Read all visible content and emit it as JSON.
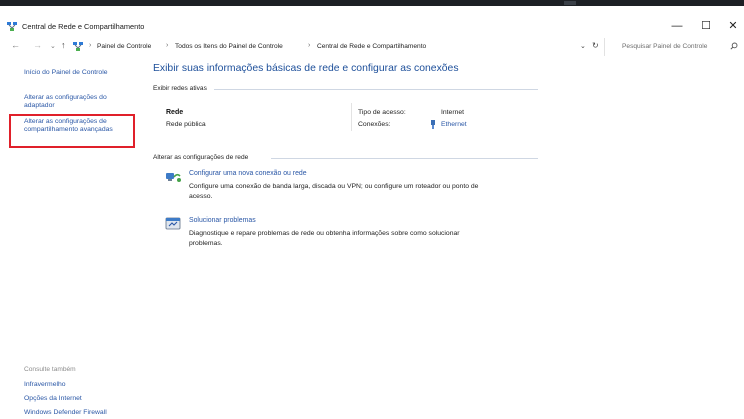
{
  "window": {
    "title": "Central de Rede e Compartilhamento",
    "controls": {
      "minimize": "—",
      "maximize": "☐",
      "close": "✕"
    }
  },
  "address_bar": {
    "back": "←",
    "forward": "→",
    "history": "⌄",
    "up": "↑",
    "lead_sep": "›",
    "breadcrumb": [
      "Painel de Controle",
      "Todos os Itens do Painel de Controle",
      "Central de Rede e Compartilhamento"
    ],
    "separator": "›",
    "dropdown": "⌄",
    "refresh": "↻",
    "search_placeholder": "Pesquisar Painel de Controle"
  },
  "sidebar": {
    "home": "Início do Painel de Controle",
    "change_adapter": [
      "Alterar as configurações do",
      "adaptador"
    ],
    "change_sharing": [
      "Alterar as configurações de",
      "compartilhamento avançadas"
    ],
    "see_also_title": "Consulte também",
    "see_also": [
      "Infravermelho",
      "Opções da Internet",
      "Windows Defender Firewall"
    ]
  },
  "main": {
    "heading": "Exibir suas informações básicas de rede e configurar as conexões",
    "active_networks_label": "Exibir redes ativas",
    "network": {
      "name": "Rede",
      "type": "Rede pública",
      "access_label": "Tipo de acesso:",
      "access_value": "Internet",
      "connections_label": "Conexões:",
      "connections_value": "Ethernet"
    },
    "change_settings_label": "Alterar as configurações de rede",
    "tasks": [
      {
        "title": "Configurar uma nova conexão ou rede",
        "desc": [
          "Configure uma conexão de banda larga, discada ou VPN; ou configure um roteador ou ponto de",
          "acesso."
        ]
      },
      {
        "title": "Solucionar problemas",
        "desc": [
          "Diagnostique e repare problemas de rede ou obtenha informações sobre como solucionar",
          "problemas."
        ]
      }
    ]
  },
  "colors": {
    "link": "#2a57a6",
    "heading": "#1d4f9a",
    "highlight": "#e0202a"
  },
  "icons": [
    "network-center-icon",
    "search-icon",
    "ethernet-icon",
    "new-connection-icon",
    "troubleshoot-icon"
  ]
}
